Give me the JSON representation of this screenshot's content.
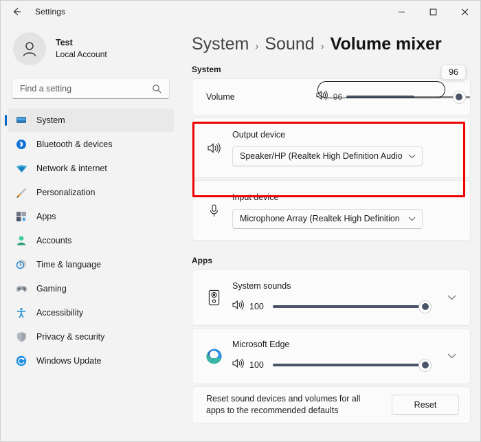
{
  "titlebar": {
    "back_label": "back-arrow",
    "title": "Settings",
    "minimize": "minimize",
    "maximize": "maximize",
    "close": "close"
  },
  "sidebar": {
    "account": {
      "name": "Test",
      "type": "Local Account"
    },
    "search": {
      "placeholder": "Find a setting",
      "value": "",
      "icon": "search-icon"
    },
    "items": [
      {
        "label": "System",
        "icon": "system-icon",
        "selected": true
      },
      {
        "label": "Bluetooth & devices",
        "icon": "bluetooth-icon",
        "selected": false
      },
      {
        "label": "Network & internet",
        "icon": "network-icon",
        "selected": false
      },
      {
        "label": "Personalization",
        "icon": "personalization-icon",
        "selected": false
      },
      {
        "label": "Apps",
        "icon": "apps-icon",
        "selected": false
      },
      {
        "label": "Accounts",
        "icon": "accounts-icon",
        "selected": false
      },
      {
        "label": "Time & language",
        "icon": "time-language-icon",
        "selected": false
      },
      {
        "label": "Gaming",
        "icon": "gaming-icon",
        "selected": false
      },
      {
        "label": "Accessibility",
        "icon": "accessibility-icon",
        "selected": false
      },
      {
        "label": "Privacy & security",
        "icon": "privacy-security-icon",
        "selected": false
      },
      {
        "label": "Windows Update",
        "icon": "windows-update-icon",
        "selected": false
      }
    ]
  },
  "content": {
    "breadcrumb": {
      "level1": "System",
      "sep1": "›",
      "level2": "Sound",
      "sep2": "›",
      "current": "Volume mixer"
    },
    "system_section": {
      "heading": "System",
      "volume": {
        "label": "Volume",
        "icon": "speaker-icon",
        "value": "96",
        "tooltip": "96",
        "percent": 96,
        "fill_percent": 55
      },
      "output_device": {
        "label": "Output device",
        "icon": "speaker-icon",
        "value": "Speaker/HP (Realtek High Definition Audio)",
        "chevron": "chevron-down-icon"
      },
      "input_device": {
        "label": "Input device",
        "icon": "microphone-icon",
        "value": "Microphone Array (Realtek High Definition A",
        "chevron": "chevron-down-icon"
      }
    },
    "apps_section": {
      "heading": "Apps",
      "items": [
        {
          "name": "System sounds",
          "icon": "system-sounds-speaker-icon",
          "volume_icon": "speaker-icon",
          "volume": "100",
          "percent": 100,
          "expand": "chevron-down-icon"
        },
        {
          "name": "Microsoft Edge",
          "icon": "microsoft-edge-icon",
          "volume_icon": "speaker-icon",
          "volume": "100",
          "percent": 100,
          "expand": "chevron-down-icon"
        }
      ]
    },
    "reset": {
      "description": "Reset sound devices and volumes for all apps to the recommended defaults",
      "button_label": "Reset"
    }
  },
  "annotation": {
    "color": "#ee0000",
    "target": "output-device-row"
  }
}
